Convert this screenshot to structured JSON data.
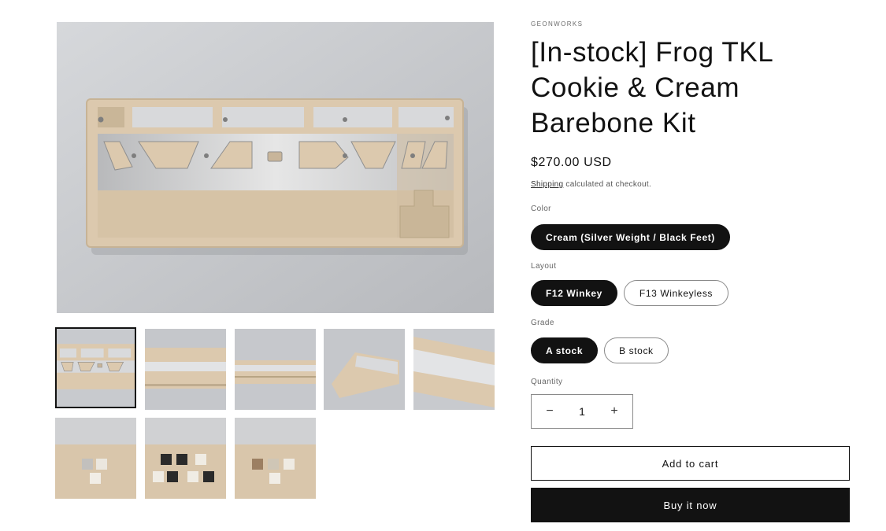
{
  "product": {
    "vendor": "GEONWORKS",
    "title": "[In-stock] Frog TKL Cookie & Cream Barebone Kit",
    "price": "$270.00 USD",
    "shipping_link": "Shipping",
    "shipping_text": " calculated at checkout."
  },
  "options": {
    "color": {
      "label": "Color",
      "values": [
        "Cream (Silver Weight / Black Feet)"
      ],
      "selected": "Cream (Silver Weight / Black Feet)"
    },
    "layout": {
      "label": "Layout",
      "values": [
        "F12 Winkey",
        "F13 Winkeyless"
      ],
      "selected": "F12 Winkey"
    },
    "grade": {
      "label": "Grade",
      "values": [
        "A stock",
        "B stock"
      ],
      "selected": "A stock"
    }
  },
  "quantity": {
    "label": "Quantity",
    "value": "1",
    "minus": "−",
    "plus": "+"
  },
  "actions": {
    "add_to_cart": "Add to cart",
    "buy_now": "Buy it now"
  },
  "gallery": {
    "active_index": 0,
    "thumbnail_count": 8
  },
  "colors": {
    "primary": "#121212",
    "case_cream": "#dcc9ae",
    "plate_silver": "#c9cacc",
    "background_gray": "#c6c8cc"
  }
}
